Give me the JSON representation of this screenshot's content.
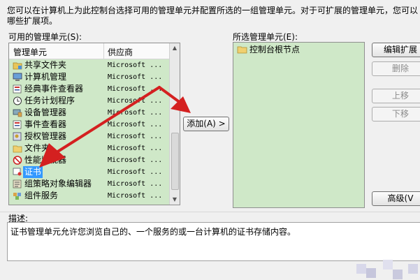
{
  "intro": {
    "line1": "您可以在计算机上为此控制台选择可用的管理单元并配置所选的一组管理单元。对于可扩展的管理单元，您可以",
    "line2": "哪些扩展项。"
  },
  "available": {
    "label": "可用的管理单元(S):",
    "col_name": "管理单元",
    "col_vendor": "供应商",
    "items": [
      {
        "name": "共享文件夹",
        "vendor": "Microsoft ...",
        "icon": "shared-folder-icon"
      },
      {
        "name": "计算机管理",
        "vendor": "Microsoft ...",
        "icon": "computer-management-icon"
      },
      {
        "name": "经典事件查看器",
        "vendor": "Microsoft ...",
        "icon": "event-viewer-icon"
      },
      {
        "name": "任务计划程序",
        "vendor": "Microsoft ...",
        "icon": "clock-icon"
      },
      {
        "name": "设备管理器",
        "vendor": "Microsoft ...",
        "icon": "device-manager-icon"
      },
      {
        "name": "事件查看器",
        "vendor": "Microsoft ...",
        "icon": "event-viewer-icon"
      },
      {
        "name": "授权管理器",
        "vendor": "Microsoft ...",
        "icon": "authorization-icon"
      },
      {
        "name": "文件夹",
        "vendor": "Microsoft ...",
        "icon": "folder-icon"
      },
      {
        "name": "性能监视器",
        "vendor": "Microsoft ...",
        "icon": "no-entry-icon"
      },
      {
        "name": "证书",
        "vendor": "Microsoft ...",
        "icon": "certificate-icon",
        "selected": true
      },
      {
        "name": "组策略对象编辑器",
        "vendor": "Microsoft ...",
        "icon": "group-policy-icon"
      },
      {
        "name": "组件服务",
        "vendor": "Microsoft ...",
        "icon": "component-services-icon"
      }
    ]
  },
  "add_button": "添加(A) >",
  "selected": {
    "label": "所选管理单元(E):",
    "items": [
      {
        "name": "控制台根节点",
        "icon": "folder-icon"
      }
    ]
  },
  "side_buttons": {
    "edit_ext": "编辑扩展",
    "remove": "删除",
    "move_up": "上移",
    "move_down": "下移",
    "advanced": "高级(V"
  },
  "description": {
    "label": "描述:",
    "text": "证书管理单元允许您浏览自己的、一个服务的或一台计算机的证书存储内容。"
  },
  "colors": {
    "list_bg": "#cfe8c8",
    "selection": "#3399ff",
    "annotation_arrow": "#d42020"
  }
}
